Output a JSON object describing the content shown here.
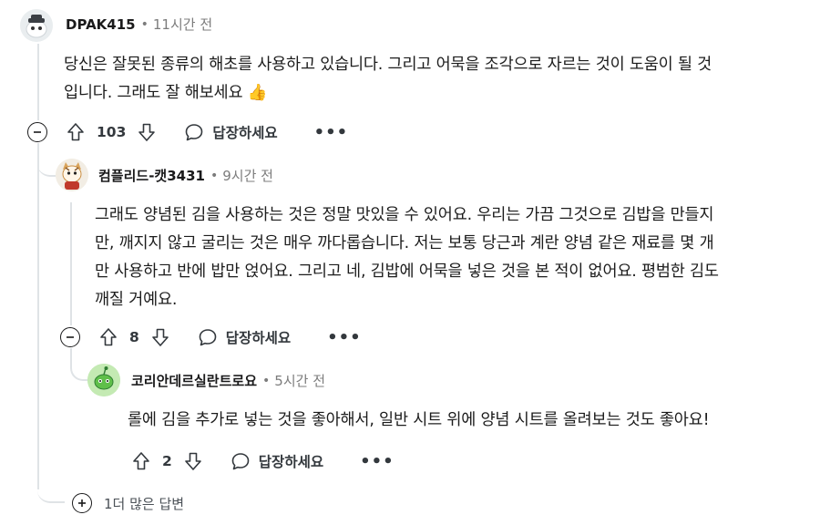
{
  "comments": [
    {
      "username": "DPAK415",
      "separator": "•",
      "time": "11시간 전",
      "body_lines": [
        "당신은 잘못된 종류의 해초를 사용하고 있습니다. 그리고 어묵을 조각으로 자르는 것이 도움이 될 것",
        "입니다. 그래도 잘 해보세요 👍"
      ],
      "score": "103",
      "reply_label": "답장하세요",
      "more_label": "•••",
      "avatar_icon": "snoo-avatar-icon"
    },
    {
      "username": "컴플리드-캣3431",
      "separator": "•",
      "time": "9시간 전",
      "body_lines": [
        "그래도 양념된 김을 사용하는 것은 정말 맛있을 수 있어요. 우리는 가끔 그것으로 김밥을 만들지",
        "만, 깨지지 않고 굴리는 것은 매우 까다롭습니다. 저는 보통 당근과 계란 양념 같은 재료를 몇 개",
        "만 사용하고 반에 밥만 얹어요. 그리고 네, 김밥에 어묵을 넣은 것을 본 적이 없어요. 평범한 김도",
        "깨질 거예요."
      ],
      "score": "8",
      "reply_label": "답장하세요",
      "more_label": "•••",
      "avatar_icon": "cat-avatar-icon"
    },
    {
      "username": "코리안데르실란트로요",
      "separator": "•",
      "time": "5시간 전",
      "body_lines": [
        "롤에 김을 추가로 넣는 것을 좋아해서, 일반 시트 위에 양념 시트를 올려보는 것도 좋아요!"
      ],
      "score": "2",
      "reply_label": "답장하세요",
      "more_label": "•••",
      "avatar_icon": "green-snoo-avatar-icon"
    }
  ],
  "more_replies_label": "1더 많은 답변",
  "colors": {
    "thread_line": "#dfe3e6",
    "text": "#1c1c1c",
    "meta": "#7c7c7c",
    "action": "#33383d"
  }
}
